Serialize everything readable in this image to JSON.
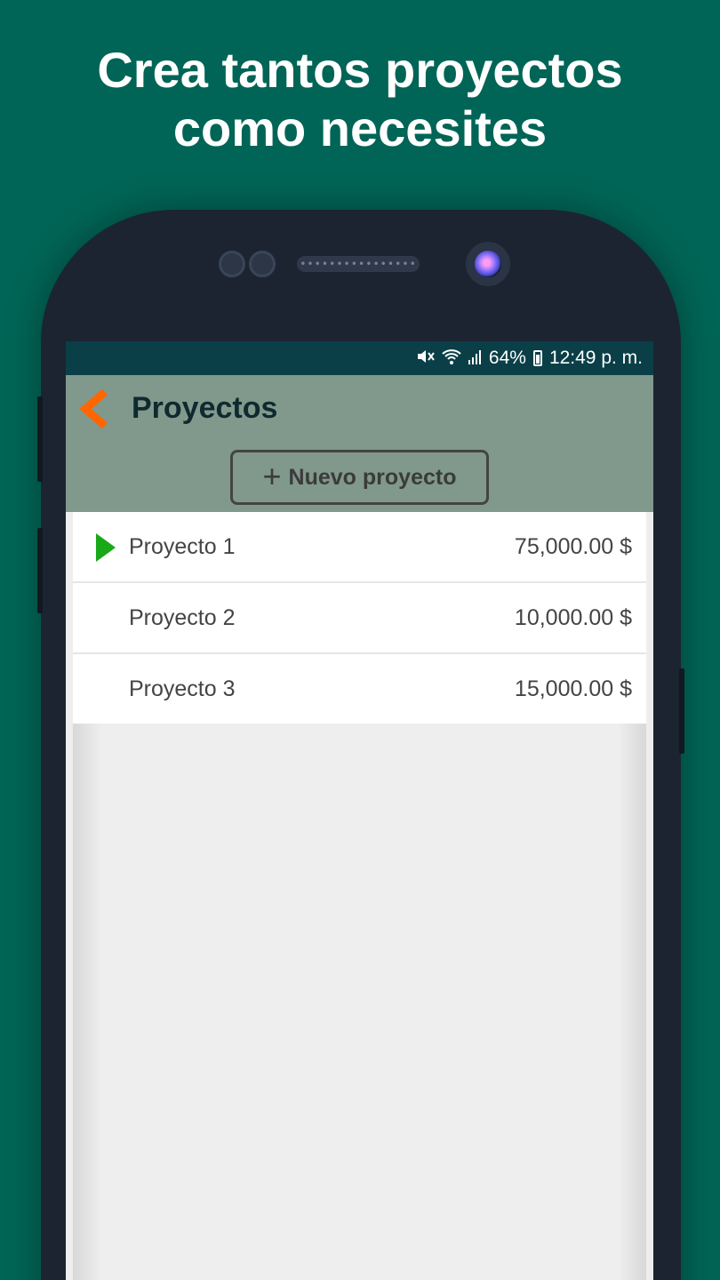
{
  "headline": {
    "line1": "Crea tantos proyectos",
    "line2": "como necesites"
  },
  "status_bar": {
    "icons": [
      "mute-icon",
      "wifi-icon",
      "signal-icon",
      "battery-icon"
    ],
    "battery": "64%",
    "time": "12:49 p. m."
  },
  "app_bar": {
    "title": "Proyectos",
    "back_icon": "chevron-left-icon",
    "new_button_label": "Nuevo proyecto",
    "new_button_icon": "plus-icon"
  },
  "projects": [
    {
      "name": "Proyecto 1",
      "amount": "75,000.00 $",
      "active": true
    },
    {
      "name": "Proyecto 2",
      "amount": "10,000.00 $",
      "active": false
    },
    {
      "name": "Proyecto 3",
      "amount": "15,000.00 $",
      "active": false
    }
  ],
  "colors": {
    "background": "#006556",
    "status_bar": "#0a3f47",
    "app_bar": "#80998c",
    "accent": "#ff6600",
    "active_marker": "#18a818"
  }
}
